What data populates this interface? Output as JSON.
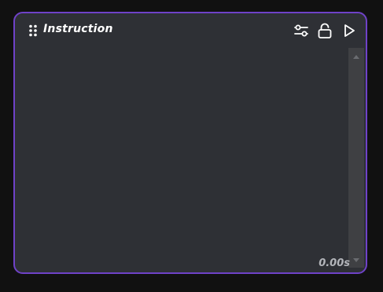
{
  "node": {
    "title": "Instruction",
    "elapsed_time": "0.00s",
    "border_color": "#6f42c8",
    "background_color": "#2e3035"
  },
  "icons": {
    "drag": "drag-handle-icon",
    "settings": "sliders-icon",
    "lock": "unlocked-icon",
    "run": "play-icon",
    "scroll_up": "chevron-up-icon",
    "scroll_down": "chevron-down-icon"
  }
}
